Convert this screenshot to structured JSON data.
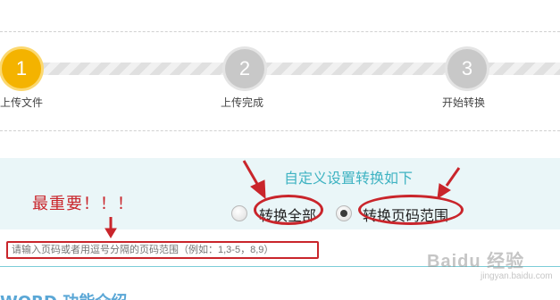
{
  "steps": [
    {
      "number": "1",
      "label": "上传文件",
      "state": "active"
    },
    {
      "number": "2",
      "label": "上传完成",
      "state": "pending"
    },
    {
      "number": "3",
      "label": "开始转换",
      "state": "pending"
    }
  ],
  "settings": {
    "title": "自定义设置转换如下",
    "options": [
      {
        "label": "转换全部",
        "checked": false
      },
      {
        "label": "转换页码范围",
        "checked": true
      }
    ],
    "range_input": {
      "value": "",
      "placeholder": "请输入页码或者用逗号分隔的页码范围（例如：1,3-5，8,9）"
    }
  },
  "annotation": {
    "note": "最重要！！！",
    "color": "#c9252b"
  },
  "section_heading": "WORD 功能介绍",
  "watermark": {
    "brand": "Baidu 经验",
    "url": "jingyan.baidu.com"
  },
  "colors": {
    "accent": "#f4b300",
    "teal": "#3fb3c2",
    "annotation_red": "#c9252b"
  }
}
